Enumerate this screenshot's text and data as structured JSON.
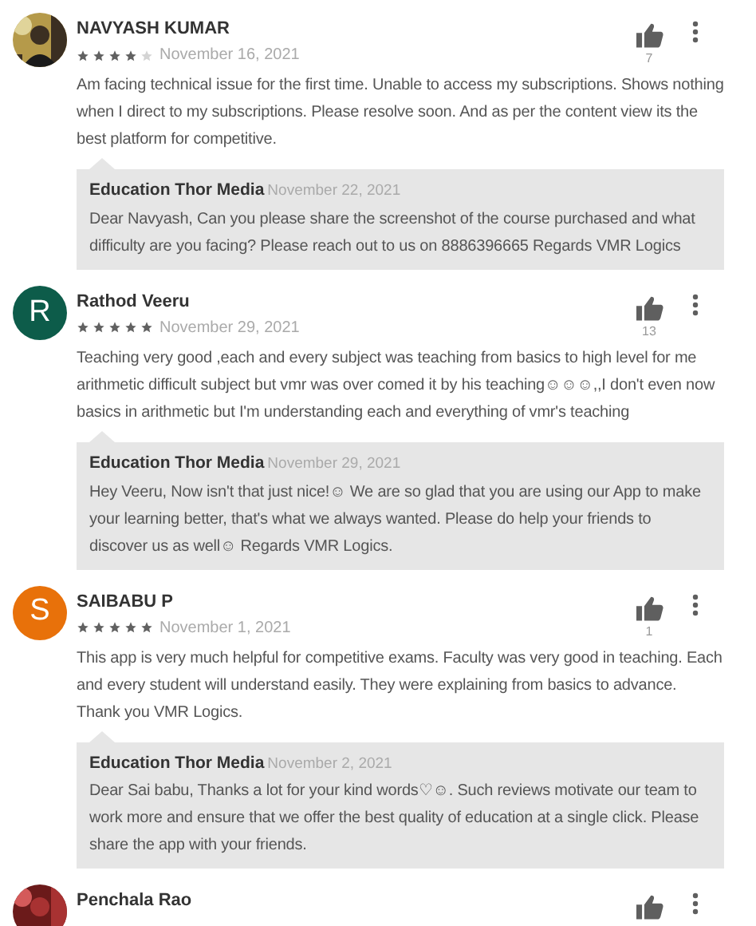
{
  "reviews": [
    {
      "author": "NAVYASH KUMAR",
      "stars": 4,
      "date": "November 16, 2021",
      "likes": "7",
      "text": "Am facing technical issue for the first time. Unable to access my subscriptions. Shows nothing when I direct to my subscriptions. Please resolve soon. And as per the content view its the best platform for competitive.",
      "reply": {
        "author": "Education Thor Media",
        "date": "November 22, 2021",
        "text": "Dear Navyash, Can you please share the screenshot of the course purchased and what difficulty are you facing? Please reach out to us on 8886396665 Regards VMR Logics"
      }
    },
    {
      "author": "Rathod Veeru",
      "avatar": {
        "kind": "letter",
        "letter": "R",
        "color": "#0d5c4a"
      },
      "stars": 5,
      "date": "November 29, 2021",
      "likes": "13",
      "text": "Teaching very good ,each and every subject was teaching from basics to high level for me arithmetic difficult subject but vmr was over comed it by his teaching☺☺☺,,I don't even now basics in arithmetic but I'm understanding each and everything of vmr's teaching",
      "reply": {
        "author": "Education Thor Media",
        "date": "November 29, 2021",
        "text": "Hey Veeru, Now isn't that just nice!☺ We are so glad that you are using our App to make your learning better, that's what we always wanted. Please do help your friends to discover us as well☺ Regards VMR Logics."
      }
    },
    {
      "author": "SAIBABU P",
      "avatar": {
        "kind": "letter",
        "letter": "S",
        "color": "#e8710a"
      },
      "stars": 5,
      "date": "November 1, 2021",
      "likes": "1",
      "text": "This app is very much helpful for competitive exams. Faculty was very good in teaching. Each and every student will understand easily. They were explaining from basics to advance. Thank you VMR Logics.",
      "reply": {
        "author": "Education Thor Media",
        "date": "November 2, 2021",
        "text": "Dear Sai babu, Thanks a lot for your kind words♡☺. Such reviews motivate our team to work more and ensure that we offer the best quality of education at a single click. Please share the app with your friends."
      }
    },
    {
      "author": "Penchala Rao"
    }
  ]
}
